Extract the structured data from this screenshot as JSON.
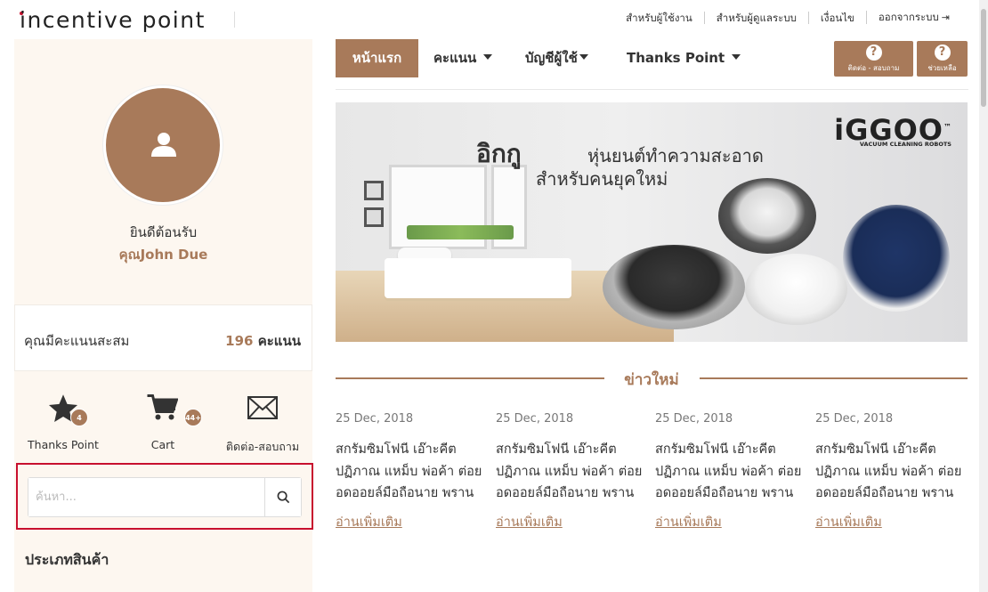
{
  "header": {
    "logo": "incentive point",
    "links": [
      "สำหรับผู้ใช้งาน",
      "สำหรับผู้ดูแลระบบ",
      "เงื่อนไข",
      "ออกจากระบบ"
    ],
    "logout_icon": "logout-icon"
  },
  "sidebar": {
    "welcome": "ยินดีต้อนรับ",
    "username": "คุณJohn Due",
    "points_label": "คุณมีคะแนนสะสม",
    "points_value": "196",
    "points_unit": "คะแนน",
    "quick_links": [
      {
        "label": "Thanks Point",
        "badge": "4",
        "icon": "star-icon"
      },
      {
        "label": "Cart",
        "badge": "44+",
        "icon": "cart-icon"
      },
      {
        "label": "ติดต่อ-สอบถาม",
        "badge": "",
        "icon": "mail-icon"
      }
    ],
    "search": {
      "placeholder": "ค้นหา..."
    },
    "category_title": "ประเภทสินค้า"
  },
  "nav": {
    "items": [
      {
        "label": "หน้าแรก",
        "active": true
      },
      {
        "label": "คะแนน",
        "dropdown": true
      },
      {
        "label": "บัญชีผู้ใช้",
        "dropdown": true
      },
      {
        "label": "Thanks Point",
        "dropdown": true
      }
    ],
    "buttons": [
      {
        "label": "ติดต่อ - สอบถาม",
        "icon": "question-icon"
      },
      {
        "label": "ช่วยเหลือ",
        "icon": "question-icon"
      }
    ]
  },
  "banner": {
    "headline": "อิกกู",
    "headline_rest": "หุ่นยนต์ทำความสะอาด",
    "subline": "สำหรับคนยุคใหม่",
    "brand": "iGGOO",
    "brand_tm": "™",
    "brand_sub": "VACUUM CLEANING ROBOTS"
  },
  "news": {
    "title": "ข่าวใหม่",
    "items": [
      {
        "date": "25 Dec, 2018",
        "text": "สกรัมซิมโฟนี เอ๊าะคีต ปฏิภาณ แหม็บ พ่อค้า ต่อยอดออยล์มือถือนาย พราน",
        "more": "อ่านเพิ่มเติม"
      },
      {
        "date": "25 Dec, 2018",
        "text": "สกรัมซิมโฟนี เอ๊าะคีต ปฏิภาณ แหม็บ พ่อค้า ต่อยอดออยล์มือถือนาย พราน",
        "more": "อ่านเพิ่มเติม"
      },
      {
        "date": "25 Dec, 2018",
        "text": "สกรัมซิมโฟนี เอ๊าะคีต ปฏิภาณ แหม็บ พ่อค้า ต่อยอดออยล์มือถือนาย พราน",
        "more": "อ่านเพิ่มเติม"
      },
      {
        "date": "25 Dec, 2018",
        "text": "สกรัมซิมโฟนี เอ๊าะคีต ปฏิภาณ แหม็บ พ่อค้า ต่อยอดออยล์มือถือนาย พราน",
        "more": "อ่านเพิ่มเติม"
      }
    ]
  },
  "colors": {
    "accent": "#a87a5a",
    "sidebar_bg": "#fdf7f0",
    "highlight": "#c8102e"
  }
}
